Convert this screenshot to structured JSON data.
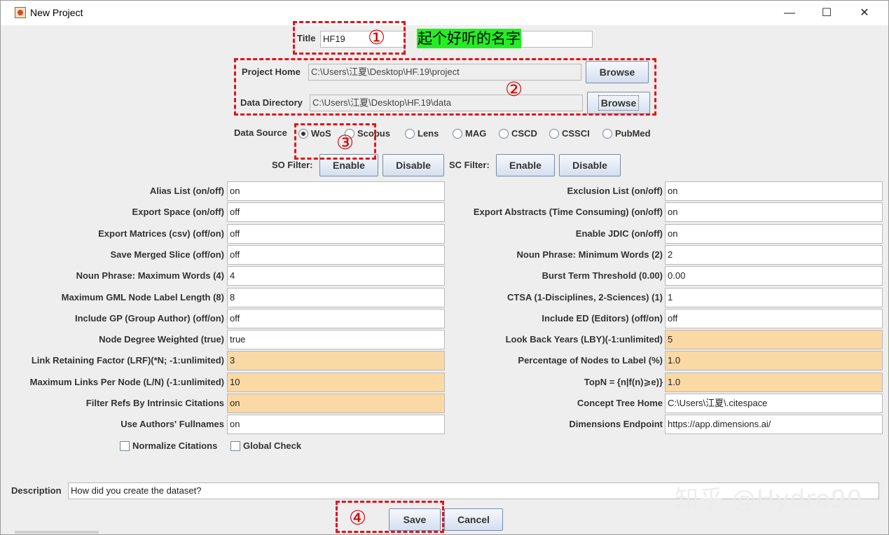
{
  "window": {
    "title": "New Project",
    "minimize_glyph": "—",
    "maximize_glyph": "☐",
    "close_glyph": "✕",
    "icon": "java-app-icon"
  },
  "title_field": {
    "label": "Title",
    "value": "HF19",
    "extra_value": ""
  },
  "annotation_note": "起个好听的名字",
  "annotation_numbers": [
    "①",
    "②",
    "③",
    "④"
  ],
  "project_home": {
    "label": "Project Home",
    "value": "C:\\Users\\江夏\\Desktop\\HF.19\\project",
    "browse": "Browse"
  },
  "data_directory": {
    "label": "Data Directory",
    "value": "C:\\Users\\江夏\\Desktop\\HF.19\\data",
    "browse": "Browse"
  },
  "data_source": {
    "label": "Data Source",
    "selected": "WoS",
    "options": [
      "WoS",
      "Scopus",
      "Lens",
      "MAG",
      "CSCD",
      "CSSCI",
      "PubMed"
    ]
  },
  "filters": {
    "so_label": "SO Filter:",
    "so_enable": "Enable",
    "so_disable": "Disable",
    "sc_label": "SC Filter:",
    "sc_enable": "Enable",
    "sc_disable": "Disable"
  },
  "left_params": [
    {
      "label": "Alias List (on/off)",
      "value": "on",
      "highlight": false
    },
    {
      "label": "Export Space (on/off)",
      "value": "off",
      "highlight": false
    },
    {
      "label": "Export Matrices (csv) (off/on)",
      "value": "off",
      "highlight": false
    },
    {
      "label": "Save Merged Slice (off/on)",
      "value": "off",
      "highlight": false
    },
    {
      "label": "Noun Phrase: Maximum Words (4)",
      "value": "4",
      "highlight": false
    },
    {
      "label": "Maximum GML Node Label Length (8)",
      "value": "8",
      "highlight": false
    },
    {
      "label": "Include GP (Group Author) (off/on)",
      "value": "off",
      "highlight": false
    },
    {
      "label": "Node Degree Weighted (true)",
      "value": "true",
      "highlight": false
    },
    {
      "label": "Link Retaining Factor (LRF)(*N; -1:unlimited)",
      "value": "3",
      "highlight": true
    },
    {
      "label": "Maximum Links Per Node (L/N) (-1:unlimited)",
      "value": "10",
      "highlight": true
    },
    {
      "label": "Filter Refs By Intrinsic Citations",
      "value": "on",
      "highlight": true
    },
    {
      "label": "Use Authors' Fullnames",
      "value": "on",
      "highlight": false
    }
  ],
  "right_params": [
    {
      "label": "Exclusion List (on/off)",
      "value": "on",
      "highlight": false
    },
    {
      "label": "Export Abstracts (Time Consuming) (on/off)",
      "value": "on",
      "highlight": false
    },
    {
      "label": "Enable JDIC (on/off)",
      "value": "on",
      "highlight": false
    },
    {
      "label": "Noun Phrase: Minimum Words (2)",
      "value": "2",
      "highlight": false
    },
    {
      "label": "Burst Term Threshold (0.00)",
      "value": "0.00",
      "highlight": false
    },
    {
      "label": "CTSA (1-Disciplines, 2-Sciences) (1)",
      "value": "1",
      "highlight": false
    },
    {
      "label": "Include ED (Editors) (off/on)",
      "value": "off",
      "highlight": false
    },
    {
      "label": "Look Back Years (LBY)(-1:unlimited)",
      "value": "5",
      "highlight": true
    },
    {
      "label": "Percentage of Nodes to Label (%)",
      "value": "1.0",
      "highlight": true
    },
    {
      "label": "TopN = {n|f(n)⩾e)}",
      "value": "1.0",
      "highlight": true
    },
    {
      "label": "Concept Tree Home",
      "value": "C:\\Users\\江夏\\.citespace",
      "highlight": false
    },
    {
      "label": "Dimensions Endpoint",
      "value": "https://app.dimensions.ai/",
      "highlight": false
    }
  ],
  "checkboxes": [
    {
      "label": "Normalize Citations",
      "checked": false
    },
    {
      "label": "Global Check",
      "checked": false
    }
  ],
  "description": {
    "label": "Description",
    "value": "How did you create the dataset?"
  },
  "actions": {
    "save": "Save",
    "cancel": "Cancel"
  },
  "watermark": "知乎 @Hydro90",
  "colors": {
    "highlight_field": "#fbd9a5",
    "annotation_red": "#e0141c",
    "note_green": "#22ee22",
    "window_bg": "#eeeeee"
  }
}
